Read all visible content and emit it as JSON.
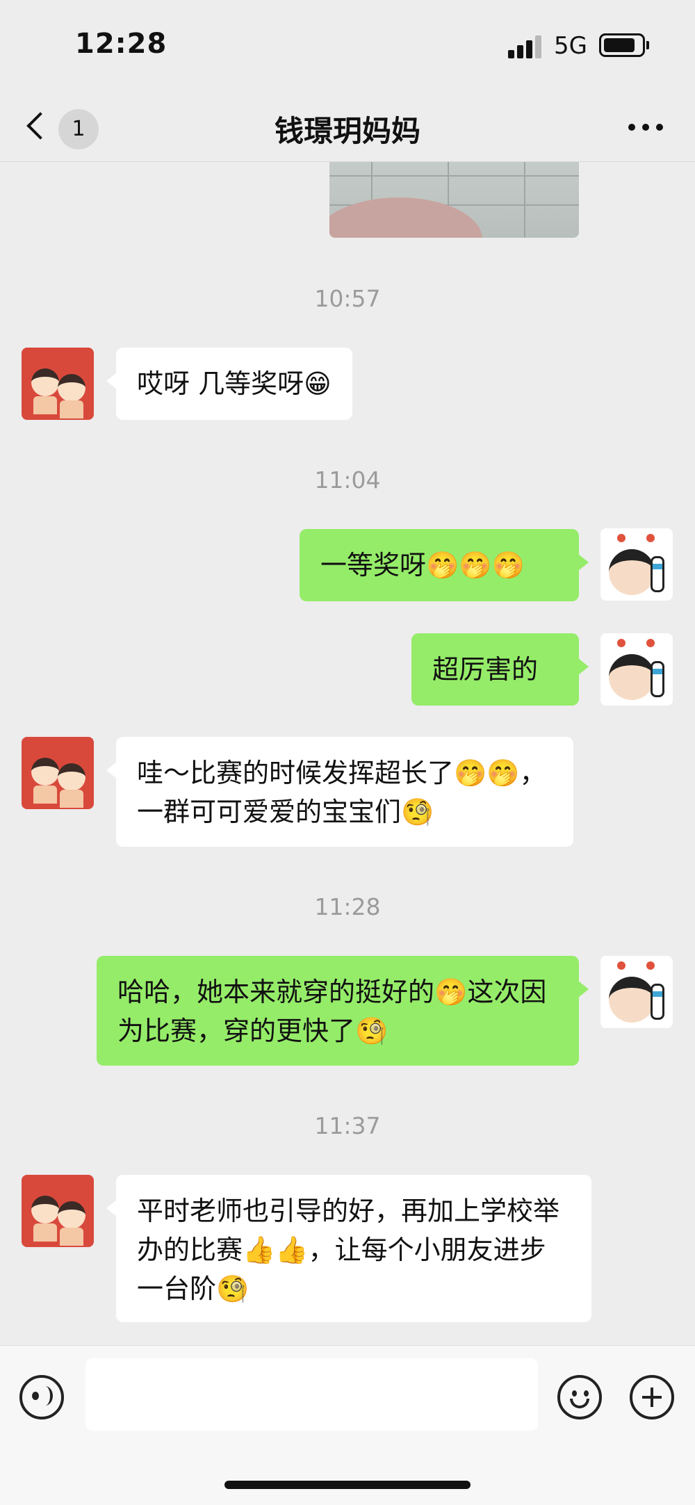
{
  "status_bar": {
    "time": "12:28",
    "network": "5G"
  },
  "nav": {
    "unread_count": "1",
    "title": "钱璟玥妈妈"
  },
  "messages": [
    {
      "time": "10:57"
    },
    {
      "sender": "contact",
      "text": "哎呀 几等奖呀😁"
    },
    {
      "time": "11:04"
    },
    {
      "sender": "self",
      "text": "一等奖呀🤭🤭🤭"
    },
    {
      "sender": "self",
      "text": "超厉害的"
    },
    {
      "sender": "contact",
      "text": "哇～比赛的时候发挥超长了🤭🤭，一群可可爱爱的宝宝们🧐"
    },
    {
      "time": "11:28"
    },
    {
      "sender": "self",
      "text": "哈哈，她本来就穿的挺好的🤭这次因为比赛，穿的更快了🧐"
    },
    {
      "time": "11:37"
    },
    {
      "sender": "contact",
      "text": "平时老师也引导的好，再加上学校举办的比赛👍👍，让每个小朋友进步一台阶🧐"
    }
  ],
  "input": {
    "placeholder": ""
  },
  "icons": [
    "back-chevron-icon",
    "more-icon",
    "voice-icon",
    "emoji-icon",
    "plus-icon"
  ]
}
